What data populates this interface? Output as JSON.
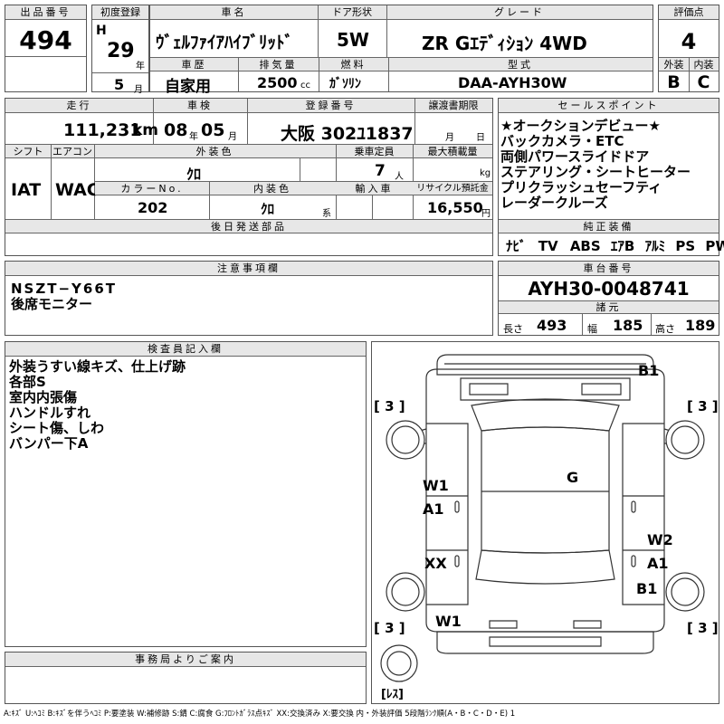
{
  "top": {
    "lot": {
      "label": "出品番号",
      "value": "494"
    },
    "first_reg": {
      "label": "初度登録",
      "era": "H",
      "year": "29",
      "year_unit": "年",
      "month": "5",
      "month_unit": "月"
    },
    "car_name": {
      "label": "車名",
      "value": "ｳﾞｪﾙﾌｧｲｱﾊｲﾌﾞﾘｯﾄﾞ"
    },
    "door": {
      "label": "ドア形状",
      "value": "5W"
    },
    "grade": {
      "label": "グレード",
      "value": "ZR Gｴﾃﾞｨｼｮﾝ 4WD"
    },
    "score": {
      "label": "評価点",
      "value": "4"
    },
    "history": {
      "label": "車歴",
      "value": "自家用"
    },
    "displacement": {
      "label": "排気量",
      "value": "2500",
      "unit": "cc"
    },
    "fuel": {
      "label": "燃料",
      "value": "ｶﾞｿﾘﾝ"
    },
    "model": {
      "label": "型式",
      "value": "DAA-AYH30W"
    },
    "exterior_grade": {
      "label": "外装",
      "value": "B"
    },
    "interior_grade": {
      "label": "内装",
      "value": "C"
    }
  },
  "mid": {
    "mileage": {
      "label": "走行",
      "value": "111,231",
      "unit": "km"
    },
    "inspection": {
      "label": "車検",
      "year": "08",
      "year_unit": "年",
      "month": "05",
      "month_unit": "月"
    },
    "plate": {
      "label": "登録番号",
      "value": "大阪 302ﾕ1837"
    },
    "transfer": {
      "label": "譲渡書期限",
      "month_unit": "月",
      "day_unit": "日"
    },
    "shift": {
      "label": "シフト",
      "value": "IAT"
    },
    "aircon": {
      "label": "エアコン",
      "value": "WAC"
    },
    "ext_color": {
      "label": "外装色",
      "value": "ｸﾛ"
    },
    "capacity": {
      "label": "乗車定員",
      "value": "7",
      "unit": "人"
    },
    "max_load": {
      "label": "最大積載量",
      "unit": "kg"
    },
    "color_no": {
      "label": "カラーNo.",
      "value": "202"
    },
    "int_color": {
      "label": "内装色",
      "value": "ｸﾛ",
      "unit": "系"
    },
    "import": {
      "label": "輸入車"
    },
    "recycle": {
      "label": "リサイクル預託金",
      "value": "16,550",
      "unit": "円"
    },
    "later_parts": {
      "label": "後日発送部品"
    }
  },
  "sales": {
    "label": "セールスポイント",
    "lines": [
      "★オークションデビュー★",
      "バックカメラ・ETC",
      "両側パワースライドドア",
      "ステアリング・シートヒーター",
      "プリクラッシュセーフティ",
      "レーダークルーズ"
    ]
  },
  "equipment": {
    "label": "純正装備",
    "items": [
      "ﾅﾋﾞ",
      "TV",
      "ABS",
      "ｴｱB",
      "ｱﾙﾐ",
      "PS",
      "PW"
    ]
  },
  "notes": {
    "label": "注意事項欄",
    "lines": [
      "NSZT−Y66T",
      "後席モニター"
    ]
  },
  "chassis": {
    "label": "車台番号",
    "value": "AYH30-0048741"
  },
  "dims": {
    "label": "諸元",
    "length_label": "長さ",
    "length": "493",
    "width_label": "幅",
    "width": "185",
    "height_label": "高さ",
    "height": "189"
  },
  "inspector": {
    "label": "検査員記入欄",
    "lines": [
      "外装うすい線キズ、仕上げ跡",
      "各部S",
      "室内内張傷",
      "ハンドルすれ",
      "シート傷、しわ",
      "バンパー下A"
    ]
  },
  "office": {
    "label": "事務局よりご案内"
  },
  "diagram": {
    "marks": [
      "B1",
      "G",
      "W1",
      "A1",
      "W2",
      "A1",
      "XX",
      "B1",
      "W1"
    ],
    "tire_labels": [
      "[ 3 ]",
      "[ 3 ]",
      "[ 3 ]",
      "[ 3 ]"
    ],
    "spare_label": "[ﾚｽ]"
  },
  "legend": "A:ｷｽﾞ U:ﾍｺﾐ B:ｷｽﾞを伴うﾍｺﾐ P:要塗装 W:補修跡 S:錆 C:腐食 G:ﾌﾛﾝﾄｶﾞﾗｽ点ｷｽﾞ XX:交換済み X:要交換 内・外装評価 5段階ﾗﾝｸ順(A・B・C・D・E) 1"
}
